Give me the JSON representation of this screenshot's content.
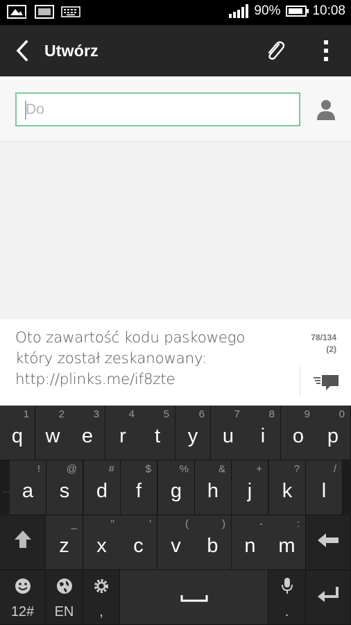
{
  "status_bar": {
    "battery_percent_text": "90%",
    "battery_level": 0.9,
    "time": "10:08",
    "icons": [
      "photo-icon",
      "image-icon",
      "keyboard-icon",
      "signal-icon",
      "battery-icon"
    ]
  },
  "action_bar": {
    "title": "Utwórz",
    "icons": [
      "back-arrow-icon",
      "paperclip-icon",
      "overflow-menu-icon"
    ]
  },
  "compose": {
    "to_placeholder": "Do",
    "message_text": "Oto zawartość kodu paskowego który został zeskanowany: http://plinks.me/if8zte",
    "char_counter": "78/134",
    "segment_count": "(2)"
  },
  "keyboard": {
    "row1": [
      {
        "main": "q",
        "hint": "1"
      },
      {
        "main": "w",
        "hint": "2"
      },
      {
        "main": "e",
        "hint": "3"
      },
      {
        "main": "r",
        "hint": "4"
      },
      {
        "main": "t",
        "hint": "5"
      },
      {
        "main": "y",
        "hint": "6"
      },
      {
        "main": "u",
        "hint": "7"
      },
      {
        "main": "i",
        "hint": "8"
      },
      {
        "main": "o",
        "hint": "9"
      },
      {
        "main": "p",
        "hint": "0"
      }
    ],
    "row2": [
      {
        "main": "a",
        "hint": "!"
      },
      {
        "main": "s",
        "hint": "@"
      },
      {
        "main": "d",
        "hint": "#"
      },
      {
        "main": "f",
        "hint": "$"
      },
      {
        "main": "g",
        "hint": "%"
      },
      {
        "main": "h",
        "hint": "&"
      },
      {
        "main": "j",
        "hint": "+"
      },
      {
        "main": "k",
        "hint": "?"
      },
      {
        "main": "l",
        "hint": "/"
      }
    ],
    "row3": [
      {
        "main": "z",
        "hint": "_"
      },
      {
        "main": "x",
        "hint": "\""
      },
      {
        "main": "c",
        "hint": "'"
      },
      {
        "main": "v",
        "hint": "("
      },
      {
        "main": "b",
        "hint": ")"
      },
      {
        "main": "n",
        "hint": "-"
      },
      {
        "main": "m",
        "hint": ":"
      }
    ],
    "row4": {
      "symbols_label": "12#",
      "language_label": "EN",
      "comma_label": ",",
      "period_label": "."
    }
  },
  "colors": {
    "action_bar": "#262626",
    "field_border": "#7ec79f",
    "keyboard_bg": "#1d1d1d",
    "key_bg": "#2e2e2e"
  }
}
